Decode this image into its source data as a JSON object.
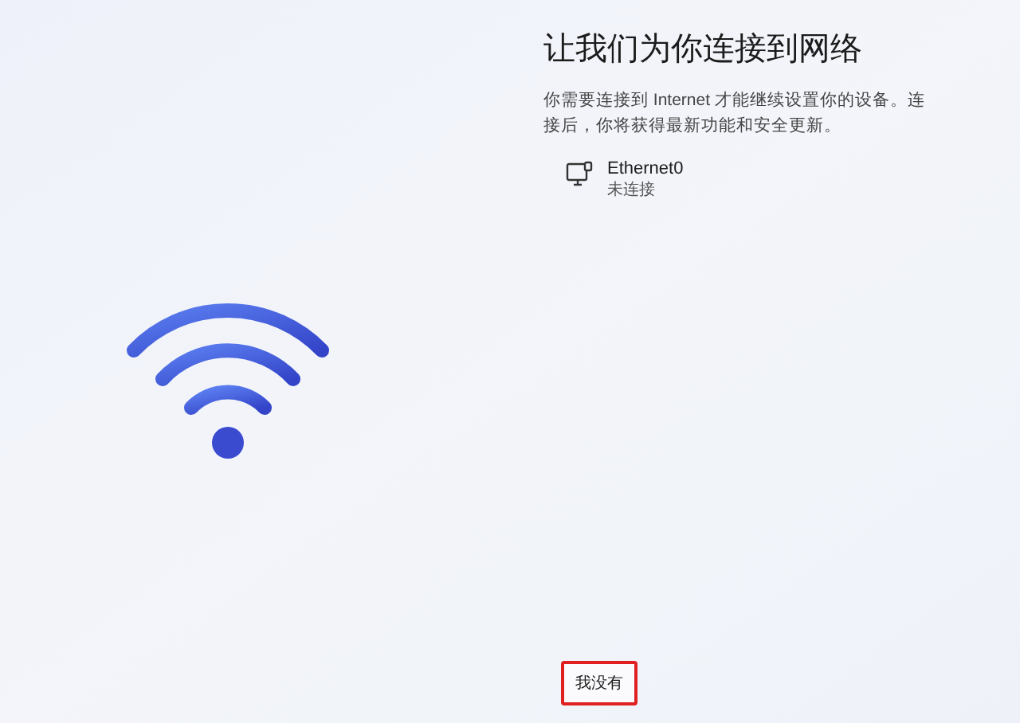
{
  "title": "让我们为你连接到网络",
  "description": "你需要连接到 Internet 才能继续设置你的设备。连接后，你将获得最新功能和安全更新。",
  "networks": [
    {
      "name": "Ethernet0",
      "status": "未连接"
    }
  ],
  "skip_button": {
    "label": "我没有",
    "highlighted": true
  }
}
